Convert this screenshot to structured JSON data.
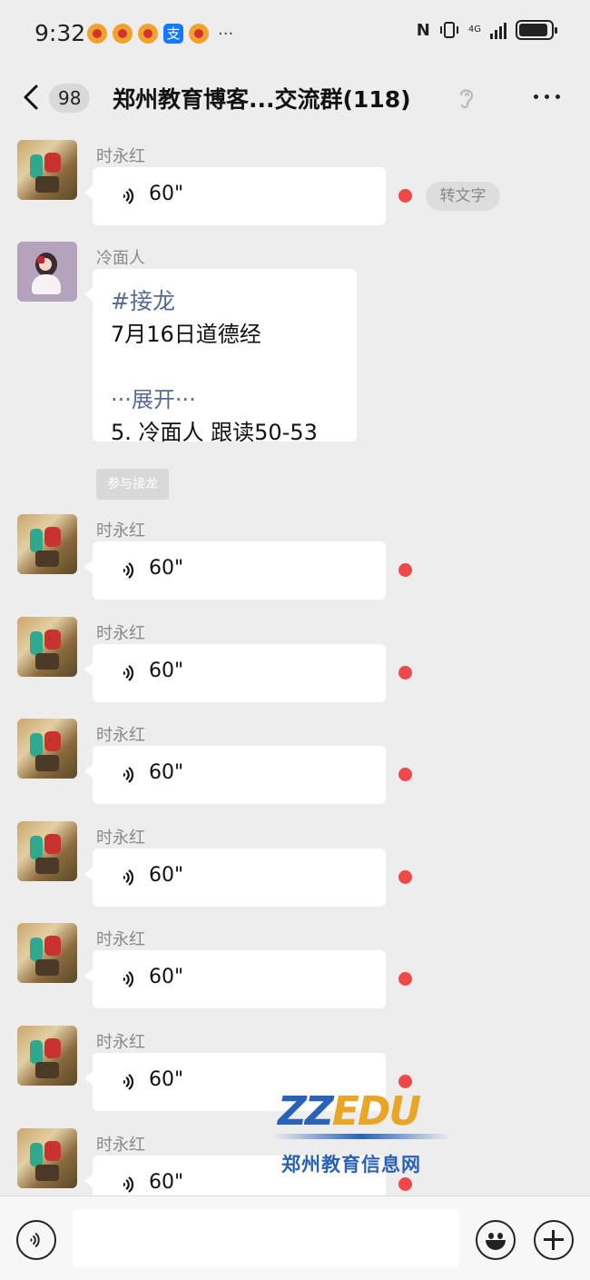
{
  "status_bar": {
    "time": "9:32",
    "more": "···",
    "network": "4G",
    "nfc": "N",
    "app_icons": [
      "weibo-icon",
      "weibo-icon",
      "weibo-icon",
      "alipay-icon",
      "weibo-icon"
    ],
    "alipay_glyph": "支"
  },
  "header": {
    "unread_count": "98",
    "title": "郑州教育博客...交流群(118)"
  },
  "messages": [
    {
      "type": "voice",
      "sender": "时永红",
      "duration": "60\"",
      "to_text": "转文字"
    },
    {
      "type": "relay",
      "sender": "冷面人",
      "tag": "#接龙",
      "topic": "7月16日道德经",
      "expand": "···展开···",
      "entry": "5. 冷面人 跟读50-53",
      "join": "参与接龙"
    },
    {
      "type": "voice",
      "sender": "时永红",
      "duration": "60\""
    },
    {
      "type": "voice",
      "sender": "时永红",
      "duration": "60\""
    },
    {
      "type": "voice",
      "sender": "时永红",
      "duration": "60\""
    },
    {
      "type": "voice",
      "sender": "时永红",
      "duration": "60\""
    },
    {
      "type": "voice",
      "sender": "时永红",
      "duration": "60\""
    },
    {
      "type": "voice",
      "sender": "时永红",
      "duration": "60\""
    },
    {
      "type": "voice",
      "sender": "时永红",
      "duration": "60\""
    }
  ],
  "watermark": {
    "logo_z": "ZZ",
    "logo_e": "EDU",
    "text": "郑州教育信息网"
  },
  "colors": {
    "background": "#ededed",
    "link_blue": "#576b95",
    "unread_dot": "#f04848"
  }
}
